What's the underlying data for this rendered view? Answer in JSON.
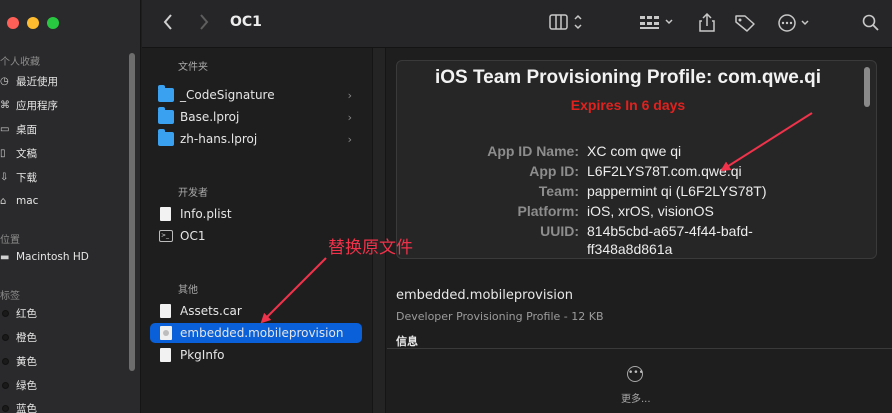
{
  "sidebar": {
    "sections": {
      "favorites": "个人收藏",
      "locations": "位置",
      "tags": "标签"
    },
    "favorites": [
      {
        "icon": "clock-icon",
        "label": "最近使用"
      },
      {
        "icon": "applications-icon",
        "label": "应用程序"
      },
      {
        "icon": "desktop-icon",
        "label": "桌面"
      },
      {
        "icon": "document-icon",
        "label": "文稿"
      },
      {
        "icon": "download-icon",
        "label": "下载"
      },
      {
        "icon": "home-icon",
        "label": "mac"
      }
    ],
    "locations": [
      {
        "icon": "disk-icon",
        "label": "Macintosh HD"
      }
    ],
    "tags": [
      {
        "label": "红色"
      },
      {
        "label": "橙色"
      },
      {
        "label": "黄色"
      },
      {
        "label": "绿色"
      },
      {
        "label": "蓝色"
      }
    ]
  },
  "toolbar": {
    "title": "OC1"
  },
  "filelist": {
    "sections": {
      "folders": "文件夹",
      "developer": "开发者",
      "other": "其他"
    },
    "folders": [
      "_CodeSignature",
      "Base.lproj",
      "zh-hans.lproj"
    ],
    "developer": [
      "Info.plist",
      "OC1"
    ],
    "other": [
      "Assets.car",
      "embedded.mobileprovision",
      "PkgInfo"
    ]
  },
  "preview": {
    "card_title": "iOS Team Provisioning Profile: com.qwe.qi",
    "expires": "Expires In 6 days",
    "rows": [
      {
        "key": "App ID Name:",
        "value": "XC com qwe qi"
      },
      {
        "key": "App ID:",
        "value": "L6F2LYS78T.com.qwe.qi"
      },
      {
        "key": "Team:",
        "value": "pappermint qi (L6F2LYS78T)"
      },
      {
        "key": "Platform:",
        "value": "iOS, xrOS, visionOS"
      },
      {
        "key": "UUID:",
        "value": "814b5cbd-a657-4f44-bafd-"
      },
      {
        "key": "",
        "value": "ff348a8d861a"
      }
    ],
    "file_name": "embedded.mobileprovision",
    "file_desc": "Developer Provisioning Profile - 12 KB",
    "info_label": "信息",
    "more_label": "更多..."
  },
  "annotation": {
    "text": "替换原文件",
    "color": "#f0324a"
  }
}
